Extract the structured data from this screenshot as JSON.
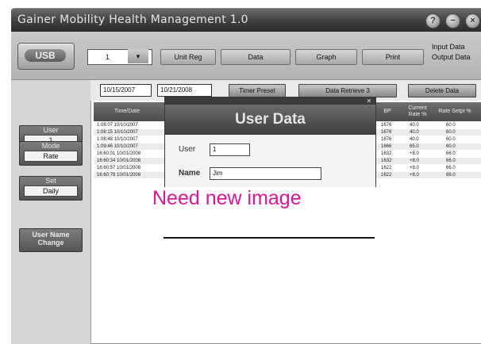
{
  "window": {
    "title": "Gainer Mobility Health Management 1.0"
  },
  "toolbar": {
    "usb_label": "USB",
    "port_value": "1",
    "port_arrow": "▾",
    "buttons": [
      "Unit Reg",
      "Data",
      "Graph",
      "Print"
    ],
    "right_labels": [
      "Input Data",
      "Output Data"
    ]
  },
  "left_panel": {
    "user_label": "User",
    "user_value": "1",
    "mode_label": "Mode",
    "mode_value": "Rate",
    "set_label": "Set",
    "set_value": "Daily",
    "username_change_label": "User Name Change"
  },
  "date_row": {
    "from_date": "10/15/2007",
    "to_date": "10/21/2008",
    "buttons": [
      "Timer Preset",
      "Data Retrieve 3",
      "Delete Data"
    ]
  },
  "table": {
    "columns": [
      "Time/Date",
      "BP",
      "Current Rate %",
      "Rate Setpt %"
    ],
    "rows": [
      {
        "time": "1:08:07 10/10/2007",
        "bp": "1676",
        "current": "40.0",
        "setpt": "60.0"
      },
      {
        "time": "1:08:15 10/10/2007",
        "bp": "1676",
        "current": "40.0",
        "setpt": "60.0"
      },
      {
        "time": "1:08:48 10/10/2007",
        "bp": "1676",
        "current": "40.0",
        "setpt": "60.0"
      },
      {
        "time": "1:09:46 10/10/2007",
        "bp": "1666",
        "current": "65.0",
        "setpt": "60.0"
      },
      {
        "time": "16:60:01 10/01/2008",
        "bp": "1632",
        "current": "+8.0",
        "setpt": "66.0"
      },
      {
        "time": "16:60:34 10/01/2008",
        "bp": "1632",
        "current": "+8.0",
        "setpt": "66.0"
      },
      {
        "time": "16:60:57 10/01/2008",
        "bp": "1622",
        "current": "+8.0",
        "setpt": "66.0"
      },
      {
        "time": "16:60:79 10/01/2008",
        "bp": "1622",
        "current": "+8.0",
        "setpt": "66.0"
      }
    ]
  },
  "dialog": {
    "title": "User Data",
    "close_glyph": "✕",
    "user_label": "User",
    "user_value": "1",
    "name_label": "Name",
    "name_value": "Jim"
  },
  "note": {
    "text": "Need new image",
    "color": "#e0149b"
  }
}
